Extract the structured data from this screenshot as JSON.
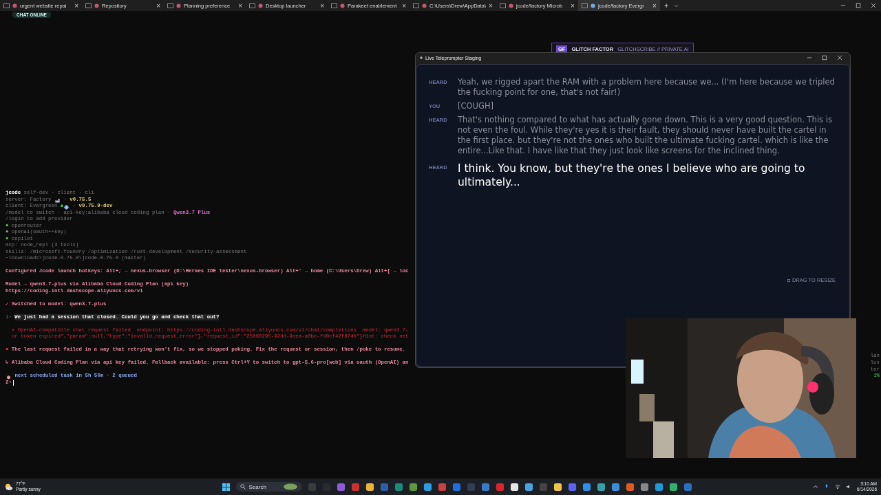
{
  "tabs": [
    {
      "label": "urgent website repai",
      "selected": false
    },
    {
      "label": "Repository",
      "selected": false
    },
    {
      "label": "Planning preference",
      "selected": false
    },
    {
      "label": "Desktop launcher",
      "selected": false
    },
    {
      "label": "Parakeet enablement",
      "selected": false
    },
    {
      "label": "C:\\Users\\Drew\\AppData\\",
      "selected": false
    },
    {
      "label": "jcode/factory Microb",
      "selected": false
    },
    {
      "label": "jcode/factory Evergr",
      "selected": true
    }
  ],
  "tab_controls": {
    "new_tab": "+",
    "close": "×"
  },
  "chat_badge": "CHAT ONLINE",
  "terminal": {
    "lines": [
      {
        "space_before": false,
        "segs": [
          {
            "kind": "bold",
            "text": "jcode"
          },
          {
            "kind": "dim",
            "text": " self-dev · client · cli"
          }
        ]
      },
      {
        "space_before": false,
        "segs": [
          {
            "kind": "dim",
            "text": "server: Factory "
          },
          {
            "kind": "factory_icon"
          },
          {
            "kind": "dim",
            "text": " · "
          },
          {
            "kind": "yellow",
            "text": "v0.75.5"
          }
        ]
      },
      {
        "space_before": false,
        "segs": [
          {
            "kind": "dim",
            "text": "client: Evergreen "
          },
          {
            "kind": "green",
            "text": "▲"
          },
          {
            "kind": "globe_icon"
          },
          {
            "kind": "dim",
            "text": " · "
          },
          {
            "kind": "yellow",
            "text": "v0.75.0-dev"
          }
        ]
      },
      {
        "space_before": false,
        "segs": [
          {
            "kind": "dim",
            "text": "/model to switch · api-key:alibaba cloud coding plan · "
          },
          {
            "kind": "magenta",
            "text": "Qwen3.7 Plus"
          }
        ]
      },
      {
        "space_before": false,
        "segs": [
          {
            "kind": "dim",
            "text": "/login to add provider"
          }
        ]
      },
      {
        "space_before": false,
        "segs": [
          {
            "kind": "green",
            "text": "●"
          },
          {
            "kind": "dim",
            "text": " openrouter"
          }
        ]
      },
      {
        "space_before": false,
        "segs": [
          {
            "kind": "green",
            "text": "●"
          },
          {
            "kind": "dim",
            "text": " openai(oauth++key)"
          }
        ]
      },
      {
        "space_before": false,
        "segs": [
          {
            "kind": "green",
            "text": "●"
          },
          {
            "kind": "dim",
            "text": " copilot"
          }
        ]
      },
      {
        "space_before": false,
        "segs": [
          {
            "kind": "dim",
            "text": "mcp: node_repl (3 tools)"
          }
        ]
      },
      {
        "space_before": false,
        "segs": [
          {
            "kind": "dim",
            "text": "skills: /microsoft-foundry /optimization /rust-development /security-assessment"
          }
        ]
      },
      {
        "space_before": false,
        "segs": [
          {
            "kind": "dim",
            "text": "~\\Downloads\\jcode-0.75.0\\jcode-0.75.0 (master)"
          }
        ]
      },
      {
        "space_before": true,
        "segs": [
          {
            "kind": "pink",
            "text": "Configured Jcode launch hotkeys: Alt+; → nexus-browser (D:\\Hermes IDE tester\\nexus-browser) Alt+' → home (C:\\Users\\Drew) Alt+[ → loc"
          }
        ]
      },
      {
        "space_before": true,
        "segs": [
          {
            "kind": "pink",
            "text": "Model → qwen3.7-plus via Alibaba Cloud Coding Plan (api key)"
          }
        ]
      },
      {
        "space_before": false,
        "segs": [
          {
            "kind": "pink",
            "text": "https://coding-intl.dashscope.aliyuncs.com/v1"
          }
        ]
      },
      {
        "space_before": true,
        "segs": [
          {
            "kind": "pink",
            "text": "✓ Switched to model: qwen3.7-plus"
          }
        ]
      },
      {
        "space_before": true,
        "segs": [
          {
            "kind": "dim",
            "text": "1› "
          },
          {
            "kind": "prompt",
            "text": "We just had a session that closed. Could you go and check that out?"
          }
        ]
      },
      {
        "space_before": true,
        "segs": [
          {
            "kind": "red",
            "text": "  × OpenAI-compatible chat request failed  endpoint: https://coding-intl.dashscope.aliyuncs.com/v1/chat/completions  model: qwen3.7-"
          }
        ]
      },
      {
        "space_before": false,
        "segs": [
          {
            "kind": "red",
            "text": "  or token expired\",\"param\":null,\"type\":\"invalid_request_error\"},\"request_id\":\"25060295-92dd-9cea-a0bc-fd0cf42f874b\"}Hint: check net"
          }
        ]
      },
      {
        "space_before": true,
        "segs": [
          {
            "kind": "reddot",
            "text": "●"
          },
          {
            "kind": "pink",
            "text": " The last request failed in a way that retrying won't fix, so we stopped poking. Fix the request or session, then /poke to resume."
          }
        ]
      },
      {
        "space_before": true,
        "segs": [
          {
            "kind": "pink",
            "text": "↳ Alibaba Cloud Coding Plan via api key failed. Fallback available: press Ctrl+Y to switch to gpt-5.6-pro[web] via oauth (OpenAI) an"
          }
        ]
      },
      {
        "space_before": true,
        "segs": [
          {
            "kind": "alarm_icon"
          },
          {
            "kind": "blue",
            "text": " next scheduled task in 5h 56m · 2 queued"
          }
        ]
      },
      {
        "space_before": false,
        "segs": [
          {
            "kind": "pink",
            "text": "2›"
          }
        ],
        "cursor": true
      }
    ],
    "side_fragments": [
      {
        "kind": "dim",
        "text": "lan"
      },
      {
        "kind": "dim",
        "text": "lus"
      },
      {
        "kind": "dim",
        "text": "ter"
      },
      {
        "kind": "green",
        "text": "1%"
      }
    ]
  },
  "glitch_widget": {
    "badge": "GF",
    "title": "GLITCH FACTOR",
    "subtitle": "GLITCHSCRIBE // PRIVATE AI"
  },
  "teleprompter": {
    "title": "Live Teleprompter Staging",
    "entries": [
      {
        "speaker": "HEARD",
        "kind": "past",
        "text": "Yeah, we rigged apart the RAM with a problem here because we... (I'm here because we tripled the fucking point for one, that's not fair!)"
      },
      {
        "speaker": "YOU",
        "kind": "past",
        "text": "[COUGH]"
      },
      {
        "speaker": "HEARD",
        "kind": "past",
        "text": "That's nothing compared to what has actually gone down. This is a very good question. This is not even the foul. While they're yes it is their fault, they should never have built the cartel in the first place. but they're not the ones who built the ultimate fucking cartel. which is like the entire...Like that. I have like that they just look like screens for the inclined thing."
      },
      {
        "speaker": "HEARD",
        "kind": "current",
        "text": "I think. You know, but they're the ones I believe who are going to ultimately..."
      }
    ],
    "resize_hint": "DRAG TO RESIZE"
  },
  "taskbar": {
    "weather": {
      "temp": "77°F",
      "desc": "Partly sunny"
    },
    "search": "Search",
    "time": "3:10 AM",
    "date": "6/14/2026"
  }
}
